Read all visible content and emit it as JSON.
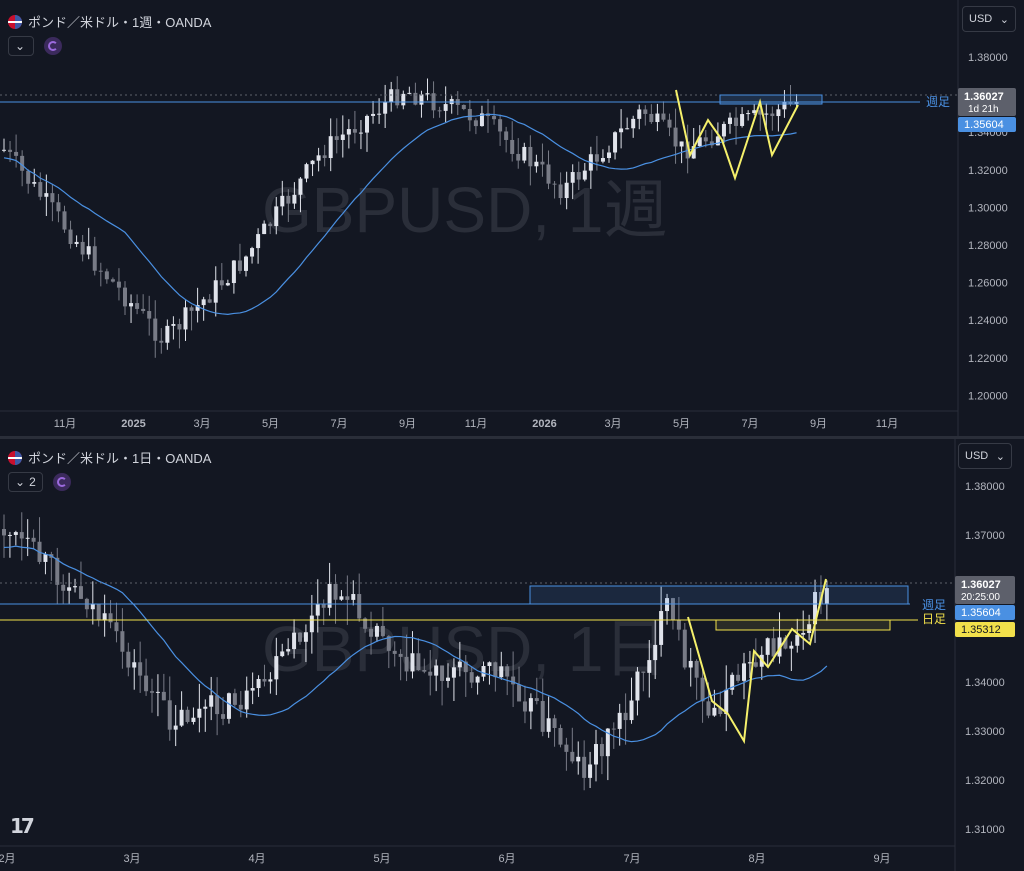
{
  "top_chart": {
    "title": "ポンド／米ドル・1週・OANDA",
    "watermark": "GBPUSD, 1週",
    "currency": "USD",
    "y_ticks": [
      "1.38000",
      "1.36000",
      "1.34000",
      "1.32000",
      "1.30000",
      "1.28000",
      "1.26000",
      "1.24000",
      "1.22000",
      "1.20000"
    ],
    "x_ticks": [
      "11月",
      "2025",
      "3月",
      "5月",
      "7月",
      "9月",
      "11月",
      "2026",
      "3月",
      "5月",
      "7月",
      "9月",
      "11月"
    ],
    "price_label": "1.36027",
    "countdown": "1d 21h",
    "ma_label": "1.35604",
    "line_label": "週足",
    "colors": {
      "ma": "#4a90e2",
      "price": "#5d606b",
      "zigzag": "#f5f06b"
    }
  },
  "bottom_chart": {
    "title": "ポンド／米ドル・1日・OANDA",
    "watermark": "GBPUSD, 1日",
    "currency": "USD",
    "indicator_count": "2",
    "y_ticks": [
      "1.38000",
      "1.37000",
      "1.36000",
      "1.35000",
      "1.34000",
      "1.33000",
      "1.32000",
      "1.31000"
    ],
    "x_ticks": [
      "2月",
      "3月",
      "4月",
      "5月",
      "6月",
      "7月",
      "8月",
      "9月"
    ],
    "price_label": "1.36027",
    "countdown": "20:25:00",
    "ma_label": "1.35604",
    "yellow_label": "1.35312",
    "line_label_weekly": "週足",
    "line_label_daily": "日足",
    "colors": {
      "ma": "#4a90e2",
      "daily_line": "#f2e04b",
      "zigzag": "#f5f06b"
    }
  },
  "logo": "TradingView"
}
